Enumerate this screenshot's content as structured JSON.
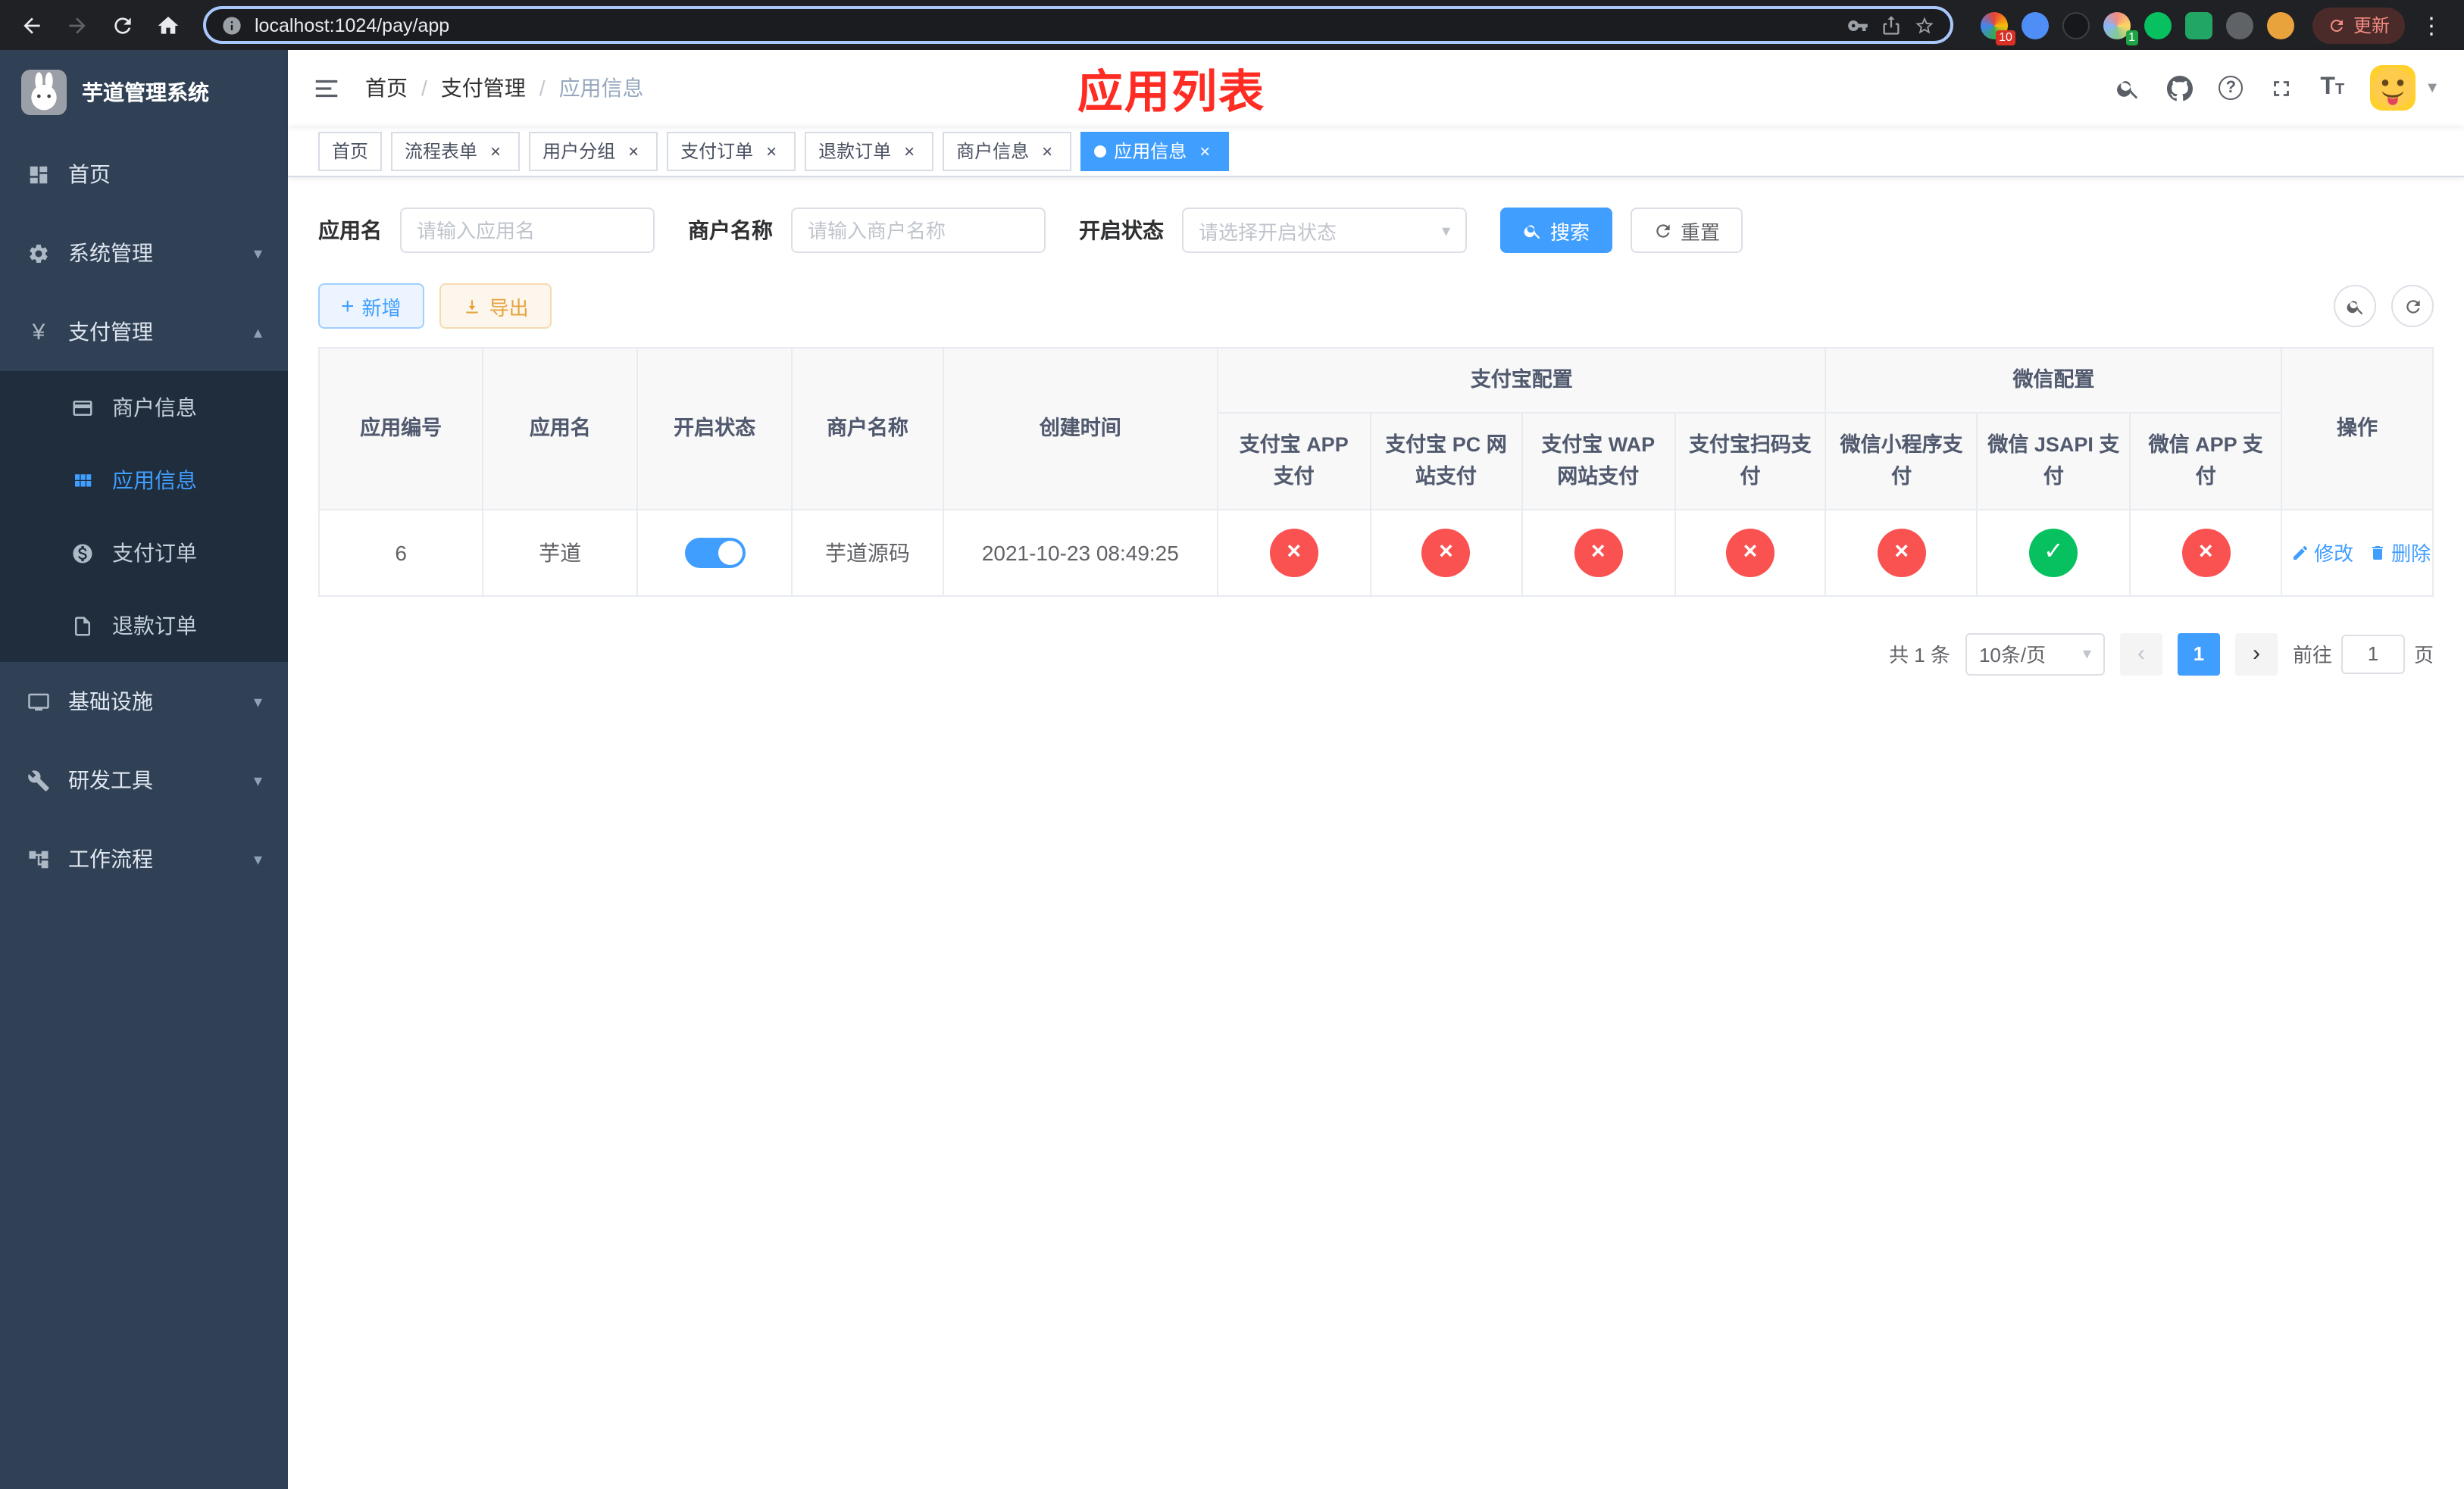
{
  "browser": {
    "url": "localhost:1024/pay/app",
    "update_label": "更新",
    "extension_badge_1": "10",
    "extension_badge_2": "1"
  },
  "glyphs": {
    "yen": "¥",
    "chevron_down": "▾",
    "chevron_up": "▴",
    "close": "×",
    "check": "✓",
    "cross": "×",
    "plus": "+",
    "question": "?",
    "prev": "‹",
    "next": "›",
    "caret_down": "▼",
    "select_caret": "▾",
    "dots_menu": "⋮",
    "font_large": "T",
    "font_small": "T",
    "breadcrumb_sep": "/"
  },
  "sidebar": {
    "logo_title": "芋道管理系统",
    "items": [
      {
        "label": "首页"
      },
      {
        "label": "系统管理"
      },
      {
        "label": "支付管理",
        "children": [
          {
            "label": "商户信息"
          },
          {
            "label": "应用信息",
            "active": true
          },
          {
            "label": "支付订单"
          },
          {
            "label": "退款订单"
          }
        ]
      },
      {
        "label": "基础设施"
      },
      {
        "label": "研发工具"
      },
      {
        "label": "工作流程"
      }
    ]
  },
  "header": {
    "breadcrumb": [
      "首页",
      "支付管理",
      "应用信息"
    ],
    "title_annotation": "应用列表"
  },
  "tabs": [
    {
      "label": "首页"
    },
    {
      "label": "流程表单"
    },
    {
      "label": "用户分组"
    },
    {
      "label": "支付订单"
    },
    {
      "label": "退款订单"
    },
    {
      "label": "商户信息"
    },
    {
      "label": "应用信息",
      "active": true
    }
  ],
  "filters": {
    "app_name_label": "应用名",
    "app_name_placeholder": "请输入应用名",
    "merchant_label": "商户名称",
    "merchant_placeholder": "请输入商户名称",
    "status_label": "开启状态",
    "status_placeholder": "请选择开启状态",
    "search_label": "搜索",
    "reset_label": "重置"
  },
  "toolbar": {
    "add_label": "新增",
    "export_label": "导出"
  },
  "table": {
    "group_alipay": "支付宝配置",
    "group_wechat": "微信配置",
    "col_app_id": "应用编号",
    "col_app_name": "应用名",
    "col_status": "开启状态",
    "col_merchant": "商户名称",
    "col_created": "创建时间",
    "col_actions": "操作",
    "alipay_cols": [
      "支付宝 APP 支付",
      "支付宝 PC 网站支付",
      "支付宝 WAP 网站支付",
      "支付宝扫码支付"
    ],
    "wechat_cols": [
      "微信小程序支付",
      "微信 JSAPI 支付",
      "微信 APP 支付"
    ],
    "rows": [
      {
        "app_id": "6",
        "app_name": "芋道",
        "enabled": true,
        "merchant": "芋道源码",
        "created_at": "2021-10-23 08:49:25",
        "channels": [
          false,
          false,
          false,
          false,
          false,
          true,
          false
        ],
        "edit_label": "修改",
        "delete_label": "删除"
      }
    ]
  },
  "pagination": {
    "total_label": "共 1 条",
    "page_size_label": "10条/页",
    "current_page": "1",
    "goto_prefix": "前往",
    "goto_value": "1",
    "goto_suffix": "页"
  },
  "colors": {
    "accent": "#409eff",
    "danger": "#fa5151",
    "success": "#07c160",
    "annotation_red": "#fe2c23",
    "sidebar_bg": "#304156",
    "submenu_bg": "#1f2d3d"
  }
}
